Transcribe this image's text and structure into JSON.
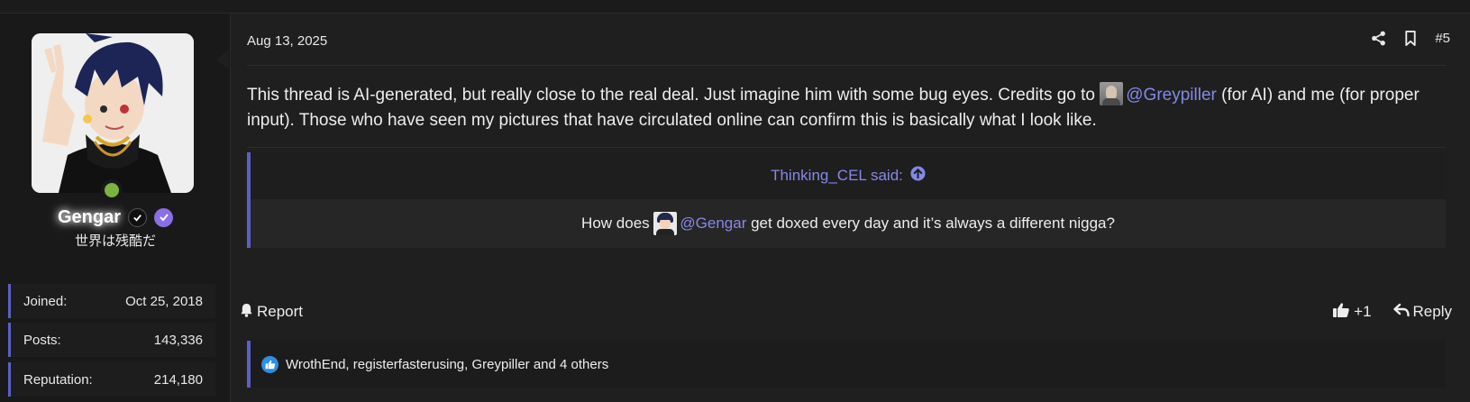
{
  "user": {
    "username": "Gengar",
    "title": "世界は残酷だ",
    "avatar_icon": "anime-avatar",
    "status_color": "#7cb342",
    "stats": [
      {
        "label": "Joined:",
        "value": "Oct 25, 2018"
      },
      {
        "label": "Posts:",
        "value": "143,336"
      },
      {
        "label": "Reputation:",
        "value": "214,180"
      }
    ]
  },
  "post": {
    "date": "Aug 13, 2025",
    "number": "#5",
    "message": {
      "part1": "This thread is AI-generated, but really close to the real deal. Just imagine him with some bug eyes. Credits go to ",
      "mention": "@Greypiller",
      "part2": " (for AI) and me (for proper input). Those who have seen my pictures that have circulated online can confirm this is basically what I look like."
    },
    "quote": {
      "author_line": "Thinking_CEL said:",
      "text_before": "How does ",
      "mention": "@Gengar",
      "text_after": " get doxed every day and it’s always a different nigga?"
    },
    "actions": {
      "report": "Report",
      "like": "+1",
      "reply": "Reply"
    },
    "reactions_text": "WrothEnd, registerfasterusing, Greypiller and 4 others"
  },
  "colors": {
    "accent": "#5c5fc4",
    "mention": "#8589e6",
    "like": "#2f8fe0",
    "verified": "#8a6ee6"
  }
}
